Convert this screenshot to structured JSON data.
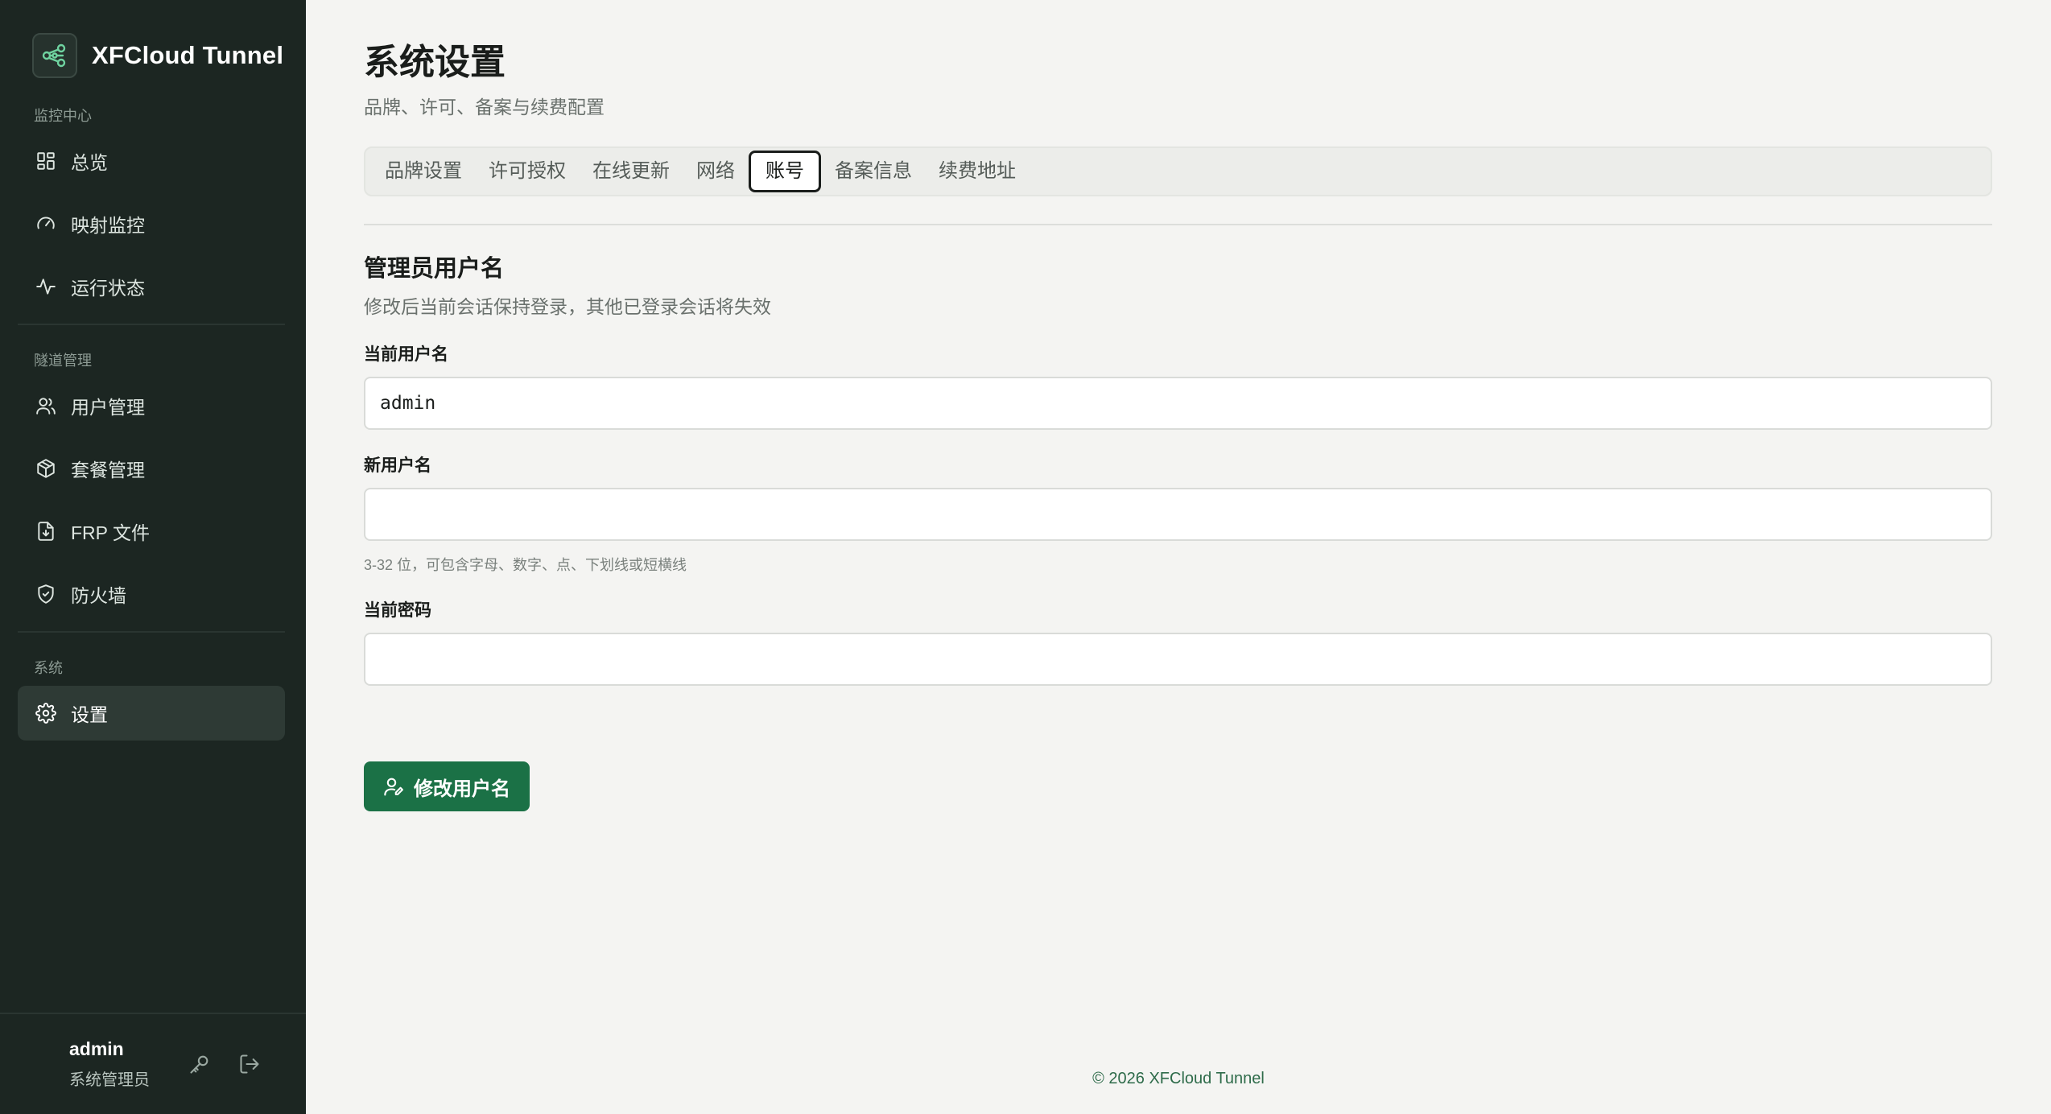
{
  "brand": {
    "name": "XFCloud Tunnel"
  },
  "sidebar": {
    "sections": [
      {
        "label": "监控中心",
        "items": [
          {
            "label": "总览",
            "icon": "grid-icon"
          },
          {
            "label": "映射监控",
            "icon": "gauge-icon"
          },
          {
            "label": "运行状态",
            "icon": "activity-icon"
          }
        ]
      },
      {
        "label": "隧道管理",
        "items": [
          {
            "label": "用户管理",
            "icon": "users-icon"
          },
          {
            "label": "套餐管理",
            "icon": "package-icon"
          },
          {
            "label": "FRP 文件",
            "icon": "file-download-icon"
          },
          {
            "label": "防火墙",
            "icon": "shield-icon"
          }
        ]
      },
      {
        "label": "系统",
        "items": [
          {
            "label": "设置",
            "icon": "gear-icon",
            "active": true
          }
        ]
      }
    ]
  },
  "user": {
    "name": "admin",
    "role": "系统管理员"
  },
  "page": {
    "title": "系统设置",
    "subtitle": "品牌、许可、备案与续费配置"
  },
  "tabs": [
    {
      "label": "品牌设置"
    },
    {
      "label": "许可授权"
    },
    {
      "label": "在线更新"
    },
    {
      "label": "网络"
    },
    {
      "label": "账号",
      "active": true
    },
    {
      "label": "备案信息"
    },
    {
      "label": "续费地址"
    }
  ],
  "account": {
    "title": "管理员用户名",
    "description": "修改后当前会话保持登录，其他已登录会话将失效",
    "current_username_label": "当前用户名",
    "current_username_value": "admin",
    "new_username_label": "新用户名",
    "new_username_value": "",
    "new_username_hint": "3-32 位，可包含字母、数字、点、下划线或短横线",
    "current_password_label": "当前密码",
    "current_password_value": "",
    "submit_label": "修改用户名"
  },
  "footer": {
    "text": "© 2026 XFCloud Tunnel"
  },
  "colors": {
    "sidebar_bg": "#1c2622",
    "accent": "#1b7146",
    "brand_icon": "#6fd3a0"
  }
}
